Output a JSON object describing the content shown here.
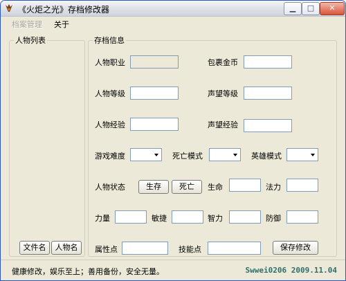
{
  "window": {
    "title": "《火炬之光》存档修改器",
    "minimize_icon": "minimize-icon",
    "maximize_icon": "maximize-icon",
    "close_icon": "close-icon"
  },
  "menu": {
    "file_management": "档案管理",
    "about": "关于"
  },
  "character_list": {
    "title": "人物列表",
    "filename_button": "文件名",
    "charname_button": "人物名"
  },
  "save_info": {
    "title": "存档信息",
    "class_label": "人物职业",
    "class_value": "",
    "gold_label": "包裹金币",
    "gold_value": "",
    "level_label": "人物等级",
    "level_value": "",
    "fame_level_label": "声望等级",
    "fame_level_value": "",
    "exp_label": "人物经验",
    "exp_value": "",
    "fame_exp_label": "声望经验",
    "fame_exp_value": "",
    "difficulty_label": "游戏难度",
    "difficulty_value": "",
    "death_mode_label": "死亡模式",
    "death_mode_value": "",
    "hero_mode_label": "英雄模式",
    "hero_mode_value": "",
    "status_label": "人物状态",
    "alive_button": "生存",
    "dead_button": "死亡",
    "life_label": "生命",
    "life_value": "",
    "mana_label": "法力",
    "mana_value": "",
    "str_label": "力量",
    "str_value": "",
    "dex_label": "敏捷",
    "dex_value": "",
    "int_label": "智力",
    "int_value": "",
    "def_label": "防御",
    "def_value": "",
    "attr_points_label": "属性点",
    "attr_points_value": "",
    "skill_points_label": "技能点",
    "skill_points_value": "",
    "save_button": "保存修改"
  },
  "status": {
    "left": "健康修改，娱乐至上；善用备份，安全无量。",
    "right": "Swwei0206 2009.11.04"
  }
}
